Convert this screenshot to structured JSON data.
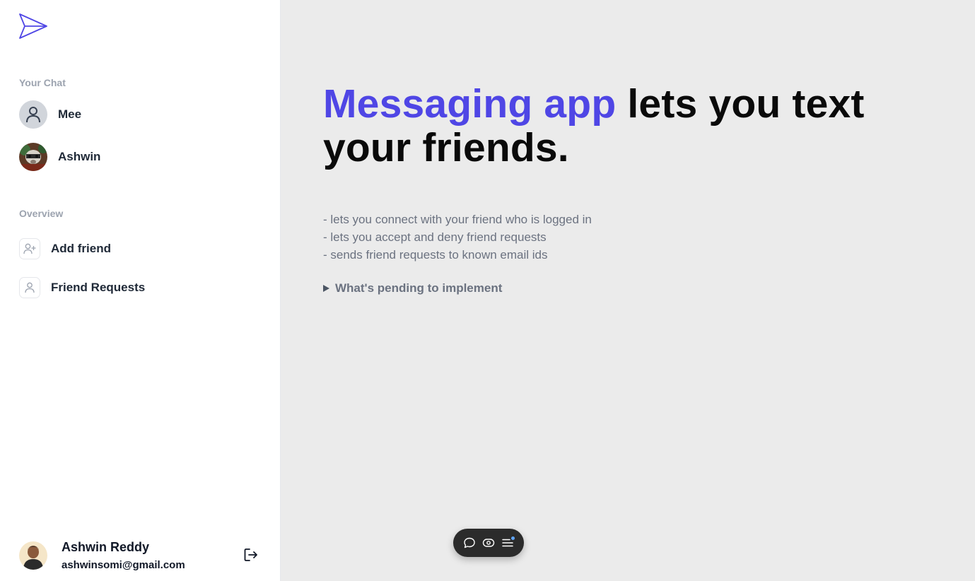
{
  "sidebar": {
    "your_chat_title": "Your Chat",
    "chats": [
      {
        "name": "Mee"
      },
      {
        "name": "Ashwin"
      }
    ],
    "overview_title": "Overview",
    "overview_items": [
      {
        "label": "Add friend",
        "icon": "user-plus-icon"
      },
      {
        "label": "Friend Requests",
        "icon": "user-icon"
      }
    ],
    "profile": {
      "name": "Ashwin Reddy",
      "email": "ashwinsomi@gmail.com"
    }
  },
  "main": {
    "headline_accent": "Messaging app",
    "headline_rest": " lets you text your friends.",
    "features": [
      "- lets you connect with your friend who is logged in",
      "- lets you accept and deny friend requests",
      "- sends friend requests to known email ids"
    ],
    "details_summary": "What's pending to implement"
  },
  "colors": {
    "accent": "#4f46e5",
    "sidebar_bg": "#ffffff",
    "main_bg": "#ebebeb"
  }
}
